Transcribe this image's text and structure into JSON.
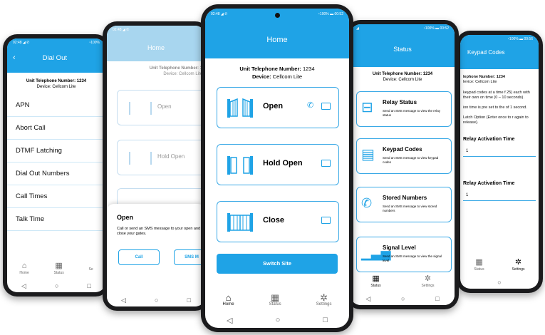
{
  "common": {
    "unit_label": "Unit Telephone Number:",
    "unit_value": "1234",
    "device_label": "Device:",
    "device_value": "Cellcom Lite",
    "tabs": [
      "Home",
      "Status",
      "Settings"
    ]
  },
  "phone1": {
    "status_left": "02:48 ◢ ✆",
    "status_right": "◔100%",
    "title": "Dial Out",
    "unit_line": "Unit Telephone Number: 1234",
    "device_line": "Device: Cellcom Lite",
    "items": [
      "APN",
      "Abort Call",
      "DTMF Latching",
      "Dial Out Numbers",
      "Call Times",
      "Talk Time"
    ],
    "tabs": [
      "Home",
      "Status",
      "Se"
    ]
  },
  "phone2": {
    "status_left": "02:48 ◢ ✆",
    "title": "Home",
    "unit_line": "Unit Telephone Number: 1",
    "device_line": "Device: Cellcom Lite",
    "cards": [
      "Open",
      "Hold Open"
    ],
    "sheet_title": "Open",
    "sheet_text": "Call or send an SMS message to your open and close your gates.",
    "call_label": "Call",
    "sms_label": "SMS M"
  },
  "phone3": {
    "status_left": "02:48 ◢ ✆",
    "status_right": "◔100% ▬ 00:52",
    "title": "Home",
    "unit_label": "Unit Telephone Number:",
    "unit_value": "1234",
    "device_label": "Device:",
    "device_value": "Cellcom Lite",
    "cards": [
      "Open",
      "Hold Open",
      "Close"
    ],
    "switch_label": "Switch Site",
    "tabs": [
      "Home",
      "Status",
      "Settings"
    ]
  },
  "phone4": {
    "status_left": "◢",
    "status_right": "◔100% ▬ 00:52",
    "title": "Status",
    "unit_line": "Unit Telephone Number: 1234",
    "device_line": "Device: Cellcom Lite",
    "cards": [
      {
        "title": "Relay Status",
        "desc": "Send an SMS message to view the relay status"
      },
      {
        "title": "Keypad Codes",
        "desc": "Send an SMS message to view keypad codes"
      },
      {
        "title": "Stored Numbers",
        "desc": "Send an SMS message to view stored numbers"
      },
      {
        "title": "Signal Level",
        "desc": "Send an SMS message to view the signal level"
      }
    ],
    "tabs": [
      "Status",
      "Settings"
    ]
  },
  "phone5": {
    "status_right": "◔100% ▬ 00:56",
    "title": "Keypad Codes",
    "unit_line": "lephone Number: 1234",
    "device_line": "levice: Cellcom Lite",
    "para1": "keypad codes at a time f 25) each with their own on time (0 – 10 seconds).",
    "para2": "ion time is pre set to the of 1 second.",
    "para3": "Latch Option (Enter once to r again to release).",
    "field_label": "Relay Activation Time",
    "field_value": "1",
    "tabs": [
      "Status",
      "Settings"
    ]
  }
}
